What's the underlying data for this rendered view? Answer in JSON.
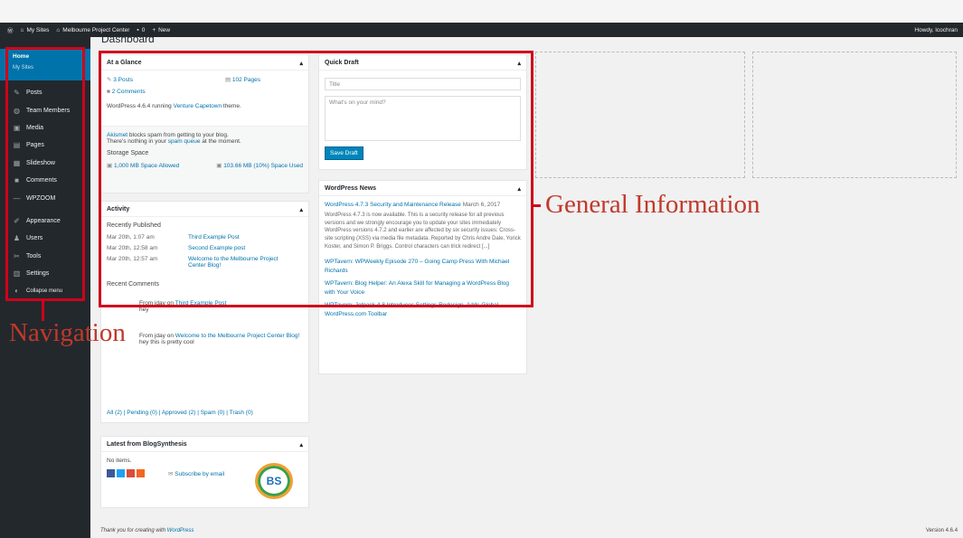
{
  "adminbar": {
    "wp_icon": "wordpress-logo-icon",
    "my_sites": "My Sites",
    "site_name": "Melbourne Project Center",
    "comments_count": "0",
    "new_label": "New",
    "howdy": "Howdy, lcochran"
  },
  "page": {
    "title": "Dashboard"
  },
  "sidebar": {
    "home": "Home",
    "my_sites": "My Sites",
    "items": [
      {
        "label": "Posts",
        "icon": "pin-icon"
      },
      {
        "label": "Team Members",
        "icon": "group-icon"
      },
      {
        "label": "Media",
        "icon": "media-icon"
      },
      {
        "label": "Pages",
        "icon": "pages-icon"
      },
      {
        "label": "Slideshow",
        "icon": "slideshow-icon"
      },
      {
        "label": "Comments",
        "icon": "comments-icon"
      },
      {
        "label": "WPZOOM",
        "icon": "wpzoom-icon"
      },
      {
        "label": "Appearance",
        "icon": "paintbrush-icon"
      },
      {
        "label": "Users",
        "icon": "users-icon"
      },
      {
        "label": "Tools",
        "icon": "tools-icon"
      },
      {
        "label": "Settings",
        "icon": "settings-icon"
      },
      {
        "label": "Collapse menu",
        "icon": "collapse-icon"
      }
    ]
  },
  "glance": {
    "title": "At a Glance",
    "posts": "3 Posts",
    "pages": "102 Pages",
    "comments": "2 Comments",
    "wp_version_prefix": "WordPress 4.6.4 running ",
    "theme": "Venture Capetown",
    "theme_suffix": " theme.",
    "akismet_link": "Akismet",
    "akismet_text": " blocks spam from getting to your blog.",
    "spam_prefix": "There's nothing in your ",
    "spam_link": "spam queue",
    "spam_suffix": " at the moment.",
    "storage_title": "Storage Space",
    "space_allowed": "1,000 MB Space Allowed",
    "space_used": "103.66 MB (10%) Space Used"
  },
  "activity": {
    "title": "Activity",
    "recent_published": "Recently Published",
    "posts": [
      {
        "date": "Mar 20th, 1:07 am",
        "title": "Third Example Post"
      },
      {
        "date": "Mar 20th, 12:58 am",
        "title": "Second Example post"
      },
      {
        "date": "Mar 20th, 12:57 am",
        "title": "Welcome to the Melbourne Project Center Blog!"
      }
    ],
    "recent_comments": "Recent Comments",
    "comment1_from": "From jday on ",
    "comment1_post": "Third Example Post",
    "comment1_text": "hey",
    "comment2_from": "From jday on ",
    "comment2_post": "Welcome to the Melbourne Project Center Blog!",
    "comment2_text": "hey this is pretty cool",
    "filters": "All (2) | Pending (0) | Approved (2) | Spam (0) | Trash (0)"
  },
  "draft": {
    "title": "Quick Draft",
    "title_placeholder": "Title",
    "content_placeholder": "What's on your mind?",
    "save_label": "Save Draft"
  },
  "news": {
    "title": "WordPress News",
    "headline": "WordPress 4.7.3 Security and Maintenance Release",
    "date": "March 6, 2017",
    "body": "WordPress 4.7.3 is now available. This is a security release for all previous versions and we strongly encourage you to update your sites immediately WordPress versions 4.7.2 and earlier are affected by six security issues: Cross-site scripting (XSS) via media file metadata. Reported by Chris Andre Dale, Yorick Koster, and Simon P. Briggs. Control characters can trick redirect [...]",
    "item1": "WPTavern: WPWeekly Episode 270 – Going Camp Press With Michael Richards",
    "item2": "WPTavern: Blog Helper: An Alexa Skill for Managing a WordPress Blog with Your Voice",
    "item3": "WPTavern: Jetpack 4.8 Introduces Settings Redesign, Adds Global WordPress.com Toolbar"
  },
  "blogsyn": {
    "title": "Latest from BlogSynthesis",
    "no_items": "No items.",
    "subscribe": "Subscribe by email",
    "logo_text": "BS"
  },
  "footer": {
    "thanks_prefix": "Thank you for creating with ",
    "thanks_link": "WordPress",
    "version": "Version 4.6.4"
  },
  "annotations": {
    "navigation": "Navigation",
    "general": "General Information",
    "color": "#c0392b"
  }
}
